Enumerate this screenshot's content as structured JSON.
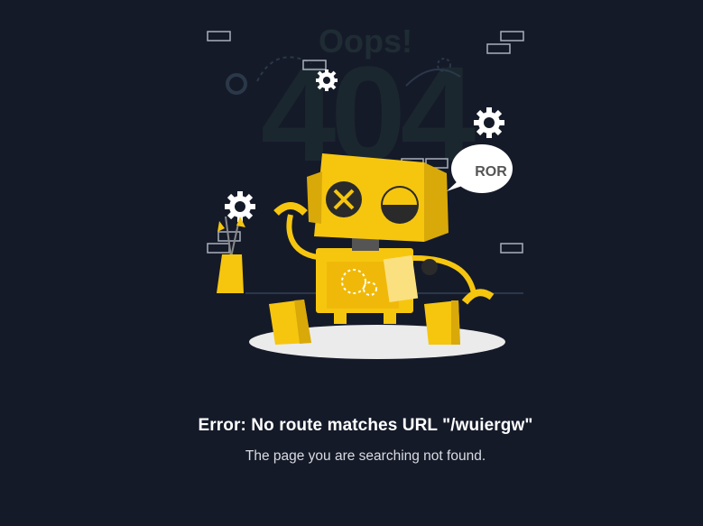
{
  "illustration": {
    "big_code": "404",
    "oops": "Oops!",
    "bubble_text": "ROR",
    "colors": {
      "background": "#151a29",
      "robot_yellow": "#f6c60f",
      "robot_shade": "#d9a90a",
      "robot_dark": "#2a2a2a",
      "big_text": "#1f2c34",
      "outline": "#aab0bd",
      "floor_shadow": "#ebebeb"
    },
    "icons": [
      "gear-icon",
      "brick-icon",
      "flower-pot"
    ]
  },
  "error": {
    "title": "Error: No route matches URL \"/wuiergw\"",
    "message": "The page you are searching not found."
  }
}
